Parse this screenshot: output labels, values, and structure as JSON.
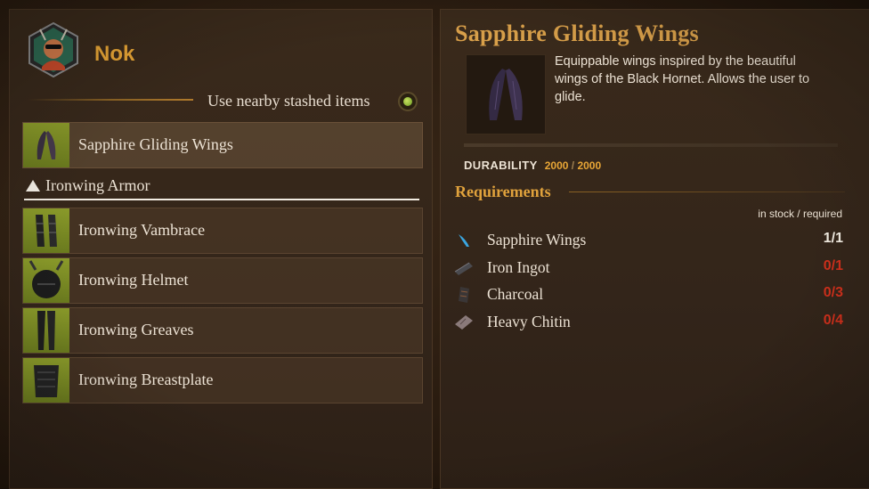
{
  "character": {
    "name": "Nok",
    "portrait_icon": "character-portrait-icon"
  },
  "stash": {
    "label": "Use nearby stashed items",
    "toggle_on": true
  },
  "list": {
    "top_item": {
      "label": "Sapphire Gliding Wings",
      "icon": "wings-icon"
    },
    "group": {
      "label": "Ironwing Armor",
      "expanded": true,
      "items": [
        {
          "label": "Ironwing Vambrace",
          "icon": "vambrace-icon"
        },
        {
          "label": "Ironwing Helmet",
          "icon": "helmet-icon"
        },
        {
          "label": "Ironwing Greaves",
          "icon": "greaves-icon"
        },
        {
          "label": "Ironwing Breastplate",
          "icon": "breastplate-icon"
        }
      ]
    }
  },
  "detail": {
    "title": "Sapphire Gliding Wings",
    "description": "Equippable wings inspired by the beautiful wings of the Black Hornet. Allows the user to glide.",
    "durability_label": "DURABILITY",
    "durability_current": "2000",
    "durability_max": "2000",
    "requirements_title": "Requirements",
    "requirements_hint": "in stock / required",
    "requirements": [
      {
        "name": "Sapphire Wings",
        "count": "1/1",
        "met": true,
        "icon": "sapphire-wing-icon"
      },
      {
        "name": "Iron Ingot",
        "count": "0/1",
        "met": false,
        "icon": "iron-ingot-icon"
      },
      {
        "name": "Charcoal",
        "count": "0/3",
        "met": false,
        "icon": "charcoal-icon"
      },
      {
        "name": "Heavy Chitin",
        "count": "0/4",
        "met": false,
        "icon": "chitin-icon"
      }
    ]
  },
  "colors": {
    "accent_gold": "#e8a636",
    "title_gold": "#d9a04a",
    "missing_red": "#d0301c",
    "thumb_green": "#8a9a2a"
  }
}
